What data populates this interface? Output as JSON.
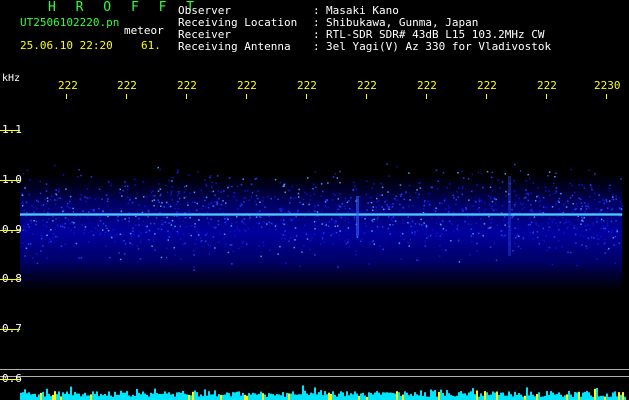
{
  "app": {
    "title": "H R O F F T"
  },
  "file": {
    "name": "UT2506102220.pn",
    "tag": "meteor"
  },
  "datetime": {
    "value": "25.06.10 22:20",
    "count": "61."
  },
  "header": {
    "rows": [
      {
        "label": "Observer",
        "sep": ":",
        "value": "Masaki Kano"
      },
      {
        "label": "Receiving Location",
        "sep": ":",
        "value": "Shibukawa, Gunma, Japan"
      },
      {
        "label": "Receiver",
        "sep": ":",
        "value": "RTL-SDR SDR# 43dB L15 103.2MHz CW"
      },
      {
        "label": "Receiving Antenna",
        "sep": ":",
        "value": "3el Yagi(V) Az 330 for Vladivostok"
      }
    ]
  },
  "axis": {
    "unit": "kHz",
    "x_ticks": [
      "222",
      "222",
      "222",
      "222",
      "222",
      "222",
      "222",
      "222",
      "222",
      "2230"
    ],
    "y_ticks": [
      "1.1",
      "1.0",
      "0.9",
      "0.8",
      "0.7",
      "0.6"
    ]
  },
  "colors": {
    "header_accent": "#33ff33",
    "axis_labels": "#ffff00",
    "signal": "#00a0ff",
    "noise": "#0000ff",
    "power_bar": "#00e5ff"
  }
}
